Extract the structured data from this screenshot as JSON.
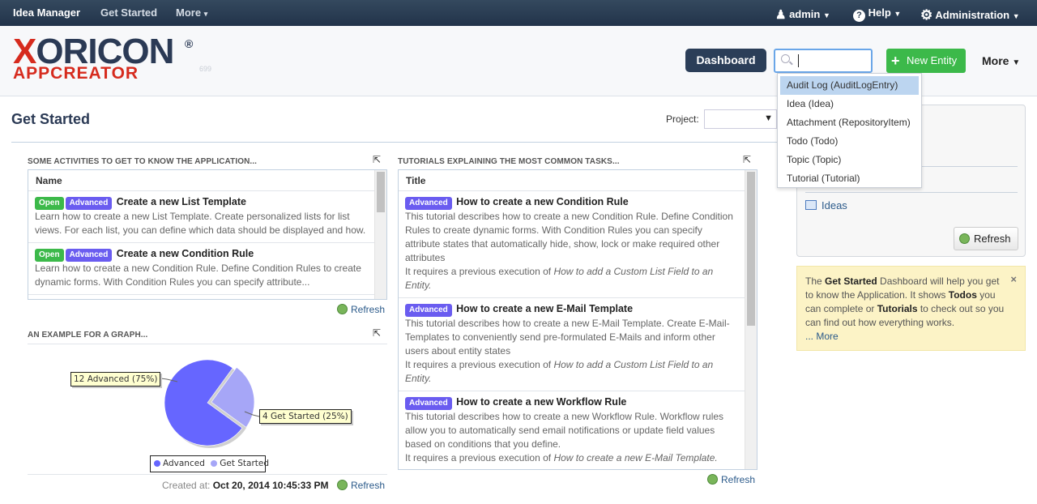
{
  "topbar": {
    "brand": "Idea Manager",
    "get_started": "Get Started",
    "more": "More",
    "user": "admin",
    "help": "Help",
    "admin": "Administration"
  },
  "header": {
    "logo_top_a": "X",
    "logo_top_b": "ORICON",
    "logo_bottom": "APPCREATOR",
    "logo_reg": "®",
    "version": "699",
    "dashboard": "Dashboard",
    "new_entity": "New Entity",
    "more": "More"
  },
  "search": {
    "value": "",
    "options": [
      "Audit Log (AuditLogEntry)",
      "Idea (Idea)",
      "Attachment (RepositoryItem)",
      "Todo (Todo)",
      "Topic (Topic)",
      "Tutorial (Tutorial)"
    ]
  },
  "page": {
    "title": "Get Started",
    "project_label": "Project:"
  },
  "activities": {
    "section": "SOME ACTIVITIES TO GET TO KNOW THE APPLICATION...",
    "col": "Name",
    "items": [
      {
        "badges": [
          "Open",
          "Advanced"
        ],
        "title": "Create a new List Template",
        "desc": "Learn how to create a new List Template. Create personalized lists for list views. For each list, you can define which data should be displayed and how."
      },
      {
        "badges": [
          "Open",
          "Advanced"
        ],
        "title": "Create a new Condition Rule",
        "desc": "Learn how to create a new Condition Rule. Define Condition Rules to create dynamic forms. With Condition Rules you can specify attribute..."
      }
    ],
    "refresh": "Refresh"
  },
  "graph": {
    "section": "AN EXAMPLE FOR A GRAPH...",
    "created_label": "Created at:",
    "created_value": "Oct 20, 2014 10:45:33 PM",
    "refresh": "Refresh"
  },
  "chart_data": {
    "type": "pie",
    "categories": [
      "Advanced",
      "Get Started"
    ],
    "values": [
      12,
      4
    ],
    "labels": [
      "12 Advanced (75%)",
      "4 Get Started (25%)"
    ],
    "colors": [
      "#6666ff",
      "#a6a6f7"
    ],
    "legend": "bottom"
  },
  "tutorials": {
    "section": "TUTORIALS EXPLAINING THE MOST COMMON TASKS...",
    "col": "Title",
    "items": [
      {
        "badge": "Advanced",
        "title": "How to create a new Condition Rule",
        "desc": "This tutorial describes how to create a new Condition Rule. Define Condition Rules to create dynamic forms. With Condition Rules you can specify attribute states that automatically hide, show, lock or make required other attributes",
        "req": "It requires a previous execution of ",
        "req_ref": "How to add a Custom List Field to an Entity."
      },
      {
        "badge": "Advanced",
        "title": "How to create a new E-Mail Template",
        "desc": "This tutorial describes how to create a new E-Mail Template. Create E-Mail-Templates to conveniently send pre-formulated E-Mails and inform other users about entity states",
        "req": "It requires a previous execution of ",
        "req_ref": "How to add a Custom List Field to an Entity."
      },
      {
        "badge": "Advanced",
        "title": "How to create a new Workflow Rule",
        "desc": "This tutorial describes how to create a new Workflow Rule. Workflow rules allow you to automatically send email notifications or update field values based on conditions that you define.",
        "req": "It requires a previous execution of ",
        "req_ref": "How to create a new E-Mail Template."
      }
    ],
    "refresh": "Refresh"
  },
  "sidebar": {
    "ideas": "Ideas",
    "refresh": "Refresh"
  },
  "info": {
    "p1": "The ",
    "b1": "Get Started",
    "p2": " Dashboard will help you get to know the Application. It shows ",
    "b2": "Todos",
    "p3": " you can complete or ",
    "b3": "Tutorials",
    "p4": " to check out so you can find out how everything works.",
    "more": "... More",
    "close": "×"
  }
}
